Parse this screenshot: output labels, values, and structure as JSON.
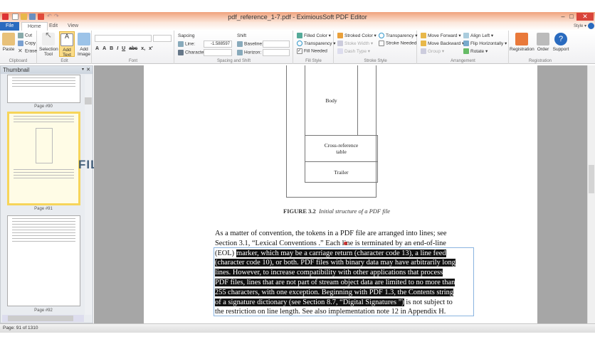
{
  "window": {
    "title": "pdf_reference_1-7.pdf - EximiousSoft PDF Editor",
    "minimize": "–",
    "maximize": "□",
    "close": "✕",
    "style_label": "Style ▾"
  },
  "tabs": [
    "File",
    "Home",
    "Edit",
    "View"
  ],
  "ribbon": {
    "clipboard": {
      "label": "Clipboard",
      "paste": "Paste",
      "cut": "Cut",
      "copy": "Copy",
      "erase": "Erase"
    },
    "edit": {
      "label": "Edit",
      "selection_tool": "Selection Tool",
      "add_text": "Add Text",
      "add_image": "Add Image"
    },
    "font": {
      "label": "Font",
      "font_name": "",
      "font_size": "",
      "buttons": [
        "A",
        "A",
        "B",
        "I",
        "U",
        "abc",
        "x,",
        "x'"
      ]
    },
    "spacing": {
      "label": "Spacing and Shift",
      "spacing_title": "Sapcing",
      "line_label": "Line:",
      "line_value": "-1.588597",
      "character_label": "Character:",
      "character_value": "",
      "shift_title": "Shift",
      "baseline_label": "Baseline:",
      "baseline_value": "",
      "horizon_label": "Horizon:",
      "horizon_value": ""
    },
    "fill": {
      "label": "Fill Style",
      "filled_color": "Filled Color ▾",
      "transparency": "Transparency ▾",
      "fill_needed": "Fill Needed"
    },
    "stroke": {
      "label": "Stroke Style",
      "stroked_color": "Stroked Color ▾",
      "stroke_width": "Stoke Width ▾",
      "dash_type": "Dash Type ▾",
      "transparency": "Transparency ▾",
      "stroke_needed": "Stroke Needed"
    },
    "arrangement": {
      "label": "Arrangement",
      "move_forward": "Move Forward ▾",
      "move_backward": "Move Backward ▾",
      "group": "Group ▾",
      "align_left": "Align Left ▾",
      "flip": "Flip Horizontally ▾",
      "rotate": "Rotate ▾"
    },
    "registration": {
      "label": "Registration",
      "registration": "Registration",
      "order": "Order",
      "support": "Support"
    }
  },
  "thumbnail": {
    "title": "Thumbnail",
    "pages": [
      "Page #90",
      "Page #91",
      "Page #92"
    ]
  },
  "document": {
    "figure_boxes": [
      "Body",
      "Cross-reference table",
      "Trailer"
    ],
    "caption_label": "FIGURE 3.2",
    "caption_text": "Initial structure of a PDF file",
    "lines": [
      [
        "As a matter of convention, the tokens in a PDF file are arranged into lines; see",
        ""
      ],
      [
        "Section 3.1, “Lexical Conventions .” Each line is terminated by an end-of-line",
        ""
      ],
      [
        "(EOL)",
        "marker, which may be a carriage return (character code 13), a line feed"
      ],
      [
        "",
        "(character code 10), or both. PDF files with binary data may have arbitrarily long"
      ],
      [
        "",
        "lines. However, to increase compatibility with other applications that process"
      ],
      [
        "",
        "PDF files, lines that are not part of stream object data are limited to no more than"
      ],
      [
        "",
        "255 characters, with one exception. Beginning with PDF 1.3, the Contents string"
      ],
      [
        "of a signature dictionary (see  Section 8.7, “Digital Signatures ”)",
        " is not subject to"
      ],
      [
        "the restriction on line length. See also implementation note 12 in Appendix H.",
        ""
      ]
    ]
  },
  "watermark": "FILECR",
  "status": "Page: 91 of 1310"
}
